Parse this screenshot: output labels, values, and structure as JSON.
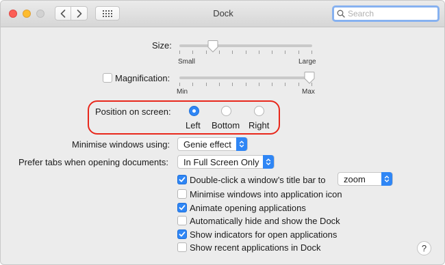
{
  "window": {
    "title": "Dock",
    "search_placeholder": "Search"
  },
  "size": {
    "label": "Size:",
    "min_label": "Small",
    "max_label": "Large",
    "level": 0.25
  },
  "magnification": {
    "label": "Magnification:",
    "checked": false,
    "min_label": "Min",
    "max_label": "Max",
    "level": 0.98
  },
  "position": {
    "label": "Position on screen:",
    "options": [
      "Left",
      "Bottom",
      "Right"
    ],
    "selected": "Left"
  },
  "minimise": {
    "label": "Minimise windows using:",
    "value": "Genie effect"
  },
  "tabs": {
    "label": "Prefer tabs when opening documents:",
    "value": "In Full Screen Only"
  },
  "double_click": {
    "label": "Double-click a window’s title bar to",
    "checked": true,
    "value": "zoom"
  },
  "checkboxes": [
    {
      "label": "Minimise windows into application icon",
      "checked": false
    },
    {
      "label": "Animate opening applications",
      "checked": true
    },
    {
      "label": "Automatically hide and show the Dock",
      "checked": false
    },
    {
      "label": "Show indicators for open applications",
      "checked": true
    },
    {
      "label": "Show recent applications in Dock",
      "checked": false
    }
  ],
  "help": "?",
  "colors": {
    "accent": "#2f86f5",
    "highlight": "#e8261a"
  }
}
